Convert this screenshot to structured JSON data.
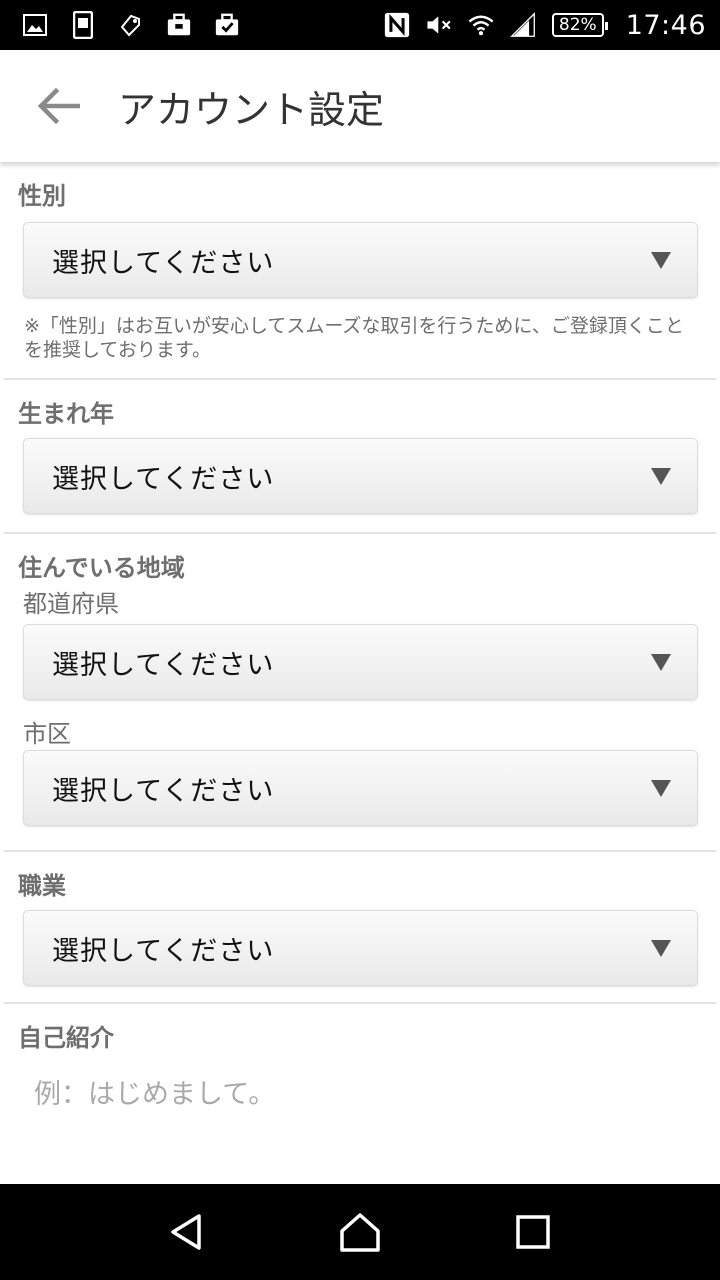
{
  "status_bar": {
    "icons": [
      "image-icon",
      "phone-screen-icon",
      "tag-icon",
      "briefcase-icon",
      "briefcase-check-icon"
    ],
    "right_icons": [
      "nfc-icon",
      "mute-icon",
      "wifi-icon",
      "signal-icon"
    ],
    "battery": "82%",
    "time": "17:46"
  },
  "app_bar": {
    "title": "アカウント設定",
    "back_icon": "arrow-left-icon"
  },
  "sections": {
    "gender": {
      "label": "性別",
      "select_value": "選択してください",
      "note": "※「性別」はお互いが安心してスムーズな取引を行うために、ご登録頂くことを推奨しております。"
    },
    "birth_year": {
      "label": "生まれ年",
      "select_value": "選択してください"
    },
    "region": {
      "label": "住んでいる地域",
      "prefecture_label": "都道府県",
      "prefecture_value": "選択してください",
      "city_label": "市区",
      "city_value": "選択してください"
    },
    "occupation": {
      "label": "職業",
      "select_value": "選択してください"
    },
    "intro": {
      "label": "自己紹介",
      "placeholder": "例：はじめまして。"
    }
  },
  "nav_bar": {
    "buttons": [
      "back-triangle-icon",
      "home-icon",
      "recents-icon"
    ]
  }
}
